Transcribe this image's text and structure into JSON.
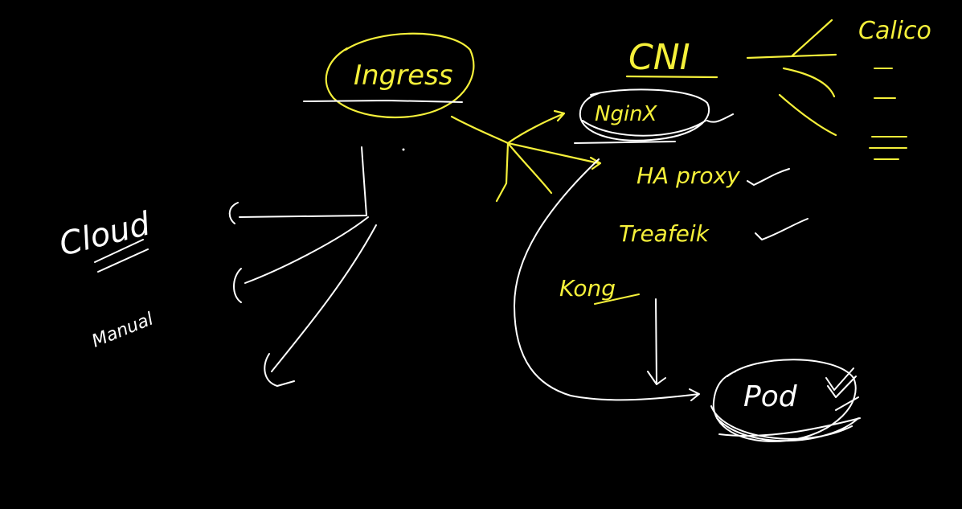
{
  "colors": {
    "background": "#000000",
    "yellow_ink": "#f5f03a",
    "white_ink": "#ffffff"
  },
  "labels": {
    "ingress": "Ingress",
    "cni": "CNI",
    "calico": "Calico",
    "nginx": "NginX",
    "haproxy": "HA proxy",
    "traefik": "Treafeik",
    "kong": "Kong",
    "cloud": "Cloud",
    "manual": "Manual",
    "pod": "Pod"
  }
}
